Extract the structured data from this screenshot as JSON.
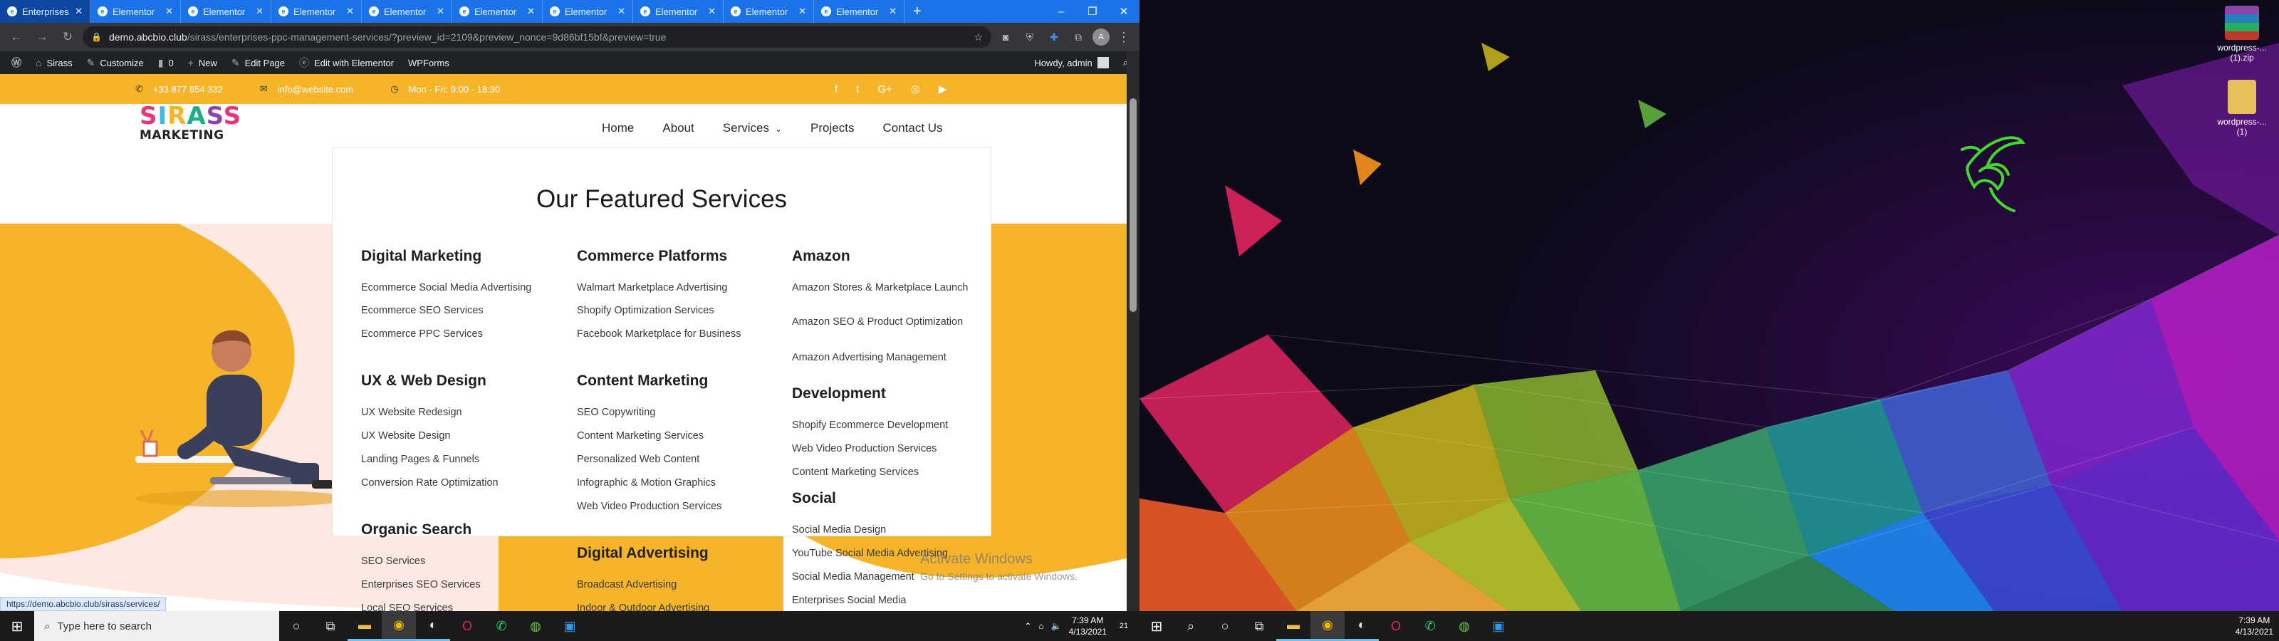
{
  "browser": {
    "tabs": [
      {
        "label": "Enterprises",
        "active": true
      },
      {
        "label": "Elementor"
      },
      {
        "label": "Elementor"
      },
      {
        "label": "Elementor"
      },
      {
        "label": "Elementor"
      },
      {
        "label": "Elementor"
      },
      {
        "label": "Elementor"
      },
      {
        "label": "Elementor"
      },
      {
        "label": "Elementor"
      },
      {
        "label": "Elementor"
      }
    ],
    "new_tab_symbol": "+",
    "window_controls": {
      "minimize": "–",
      "restore": "❐",
      "close": "✕"
    },
    "url_host": "demo.abcbio.club",
    "url_path": "/sirass/enterprises-ppc-management-services/?preview_id=2109&preview_nonce=9d86bf15bf&preview=true",
    "profile_initial": "A",
    "status_url": "https://demo.abcbio.club/sirass/services/"
  },
  "wpbar": {
    "site_name": "Sirass",
    "customize": "Customize",
    "comments_count": "0",
    "new": "New",
    "edit_page": "Edit Page",
    "edit_elementor": "Edit with Elementor",
    "wpforms": "WPForms",
    "howdy": "Howdy, admin"
  },
  "topbar": {
    "phone": "+33 877 654 332",
    "email": "info@website.com",
    "hours": "Mon - Fri: 9:00 - 18:30",
    "social": [
      "f",
      "t",
      "G+",
      "◎",
      "▶"
    ]
  },
  "logo": {
    "brand": "SIRASS",
    "sub": "MARKETING",
    "letter_colors": [
      "#e8367d",
      "#3fb7e8",
      "#f5b42a",
      "#1fae8a",
      "#8e44ad",
      "#e8367d"
    ]
  },
  "nav": {
    "items": [
      "Home",
      "About",
      "Services",
      "Projects",
      "Contact Us"
    ],
    "chevron": "⌄"
  },
  "menu": {
    "title": "Our  Featured Services",
    "columns": [
      {
        "groups": [
          {
            "title": "Digital Marketing",
            "items": [
              "Ecommerce Social Media Advertising",
              "Ecommerce SEO Services",
              "Ecommerce PPC Services"
            ]
          },
          {
            "title": "UX & Web Design",
            "items": [
              "UX Website Redesign",
              "UX Website Design",
              "Landing Pages & Funnels",
              "Conversion Rate Optimization"
            ]
          },
          {
            "title": "Organic Search",
            "items": [
              "SEO Services",
              "Enterprises SEO Services",
              "Local SEO Services"
            ]
          }
        ]
      },
      {
        "groups": [
          {
            "title": "Commerce Platforms",
            "items": [
              "Walmart Marketplace Advertising",
              "Shopify Optimization Services",
              "Facebook Marketplace for Business"
            ]
          },
          {
            "title": "Content Marketing",
            "items": [
              "SEO Copywriting",
              "Content Marketing Services",
              "Personalized Web Content",
              "Infographic & Motion Graphics",
              "Web Video Production Services"
            ]
          },
          {
            "title": "Digital Advertising",
            "items": [
              "Broadcast Advertising",
              "Indoor & Outdoor Advertising"
            ]
          }
        ]
      },
      {
        "groups": [
          {
            "title": "Amazon",
            "items": [
              "Amazon Stores & Marketplace Launch",
              "Amazon SEO & Product Optimization",
              "Amazon Advertising Management"
            ]
          },
          {
            "title": "Development",
            "items": [
              "Shopify Ecommerce Development",
              "Web Video Production Services",
              "Content Marketing Services"
            ]
          },
          {
            "title": "Social",
            "items": [
              "Social Media Design",
              "YouTube Social Media Advertising",
              "Social Media Management",
              "Enterprises Social Media"
            ]
          }
        ]
      }
    ]
  },
  "watermark": {
    "line1": "Activate Windows",
    "line2": "Go to Settings to activate Windows."
  },
  "desktop": {
    "icons": [
      {
        "label": "wordpress-...\n(1).zip",
        "color": "#c0392b"
      },
      {
        "label": "wordpress-...\n(1)",
        "color": "#e6c15a"
      }
    ],
    "logo_color": "#44d62c"
  },
  "taskbar": {
    "search_placeholder": "Type here to search",
    "time": "7:39 AM",
    "date": "4/13/2021",
    "notif_count": "21",
    "time2": "7:39 AM",
    "date2": "4/13/2021"
  },
  "colors": {
    "accent_yellow": "#f5b42a",
    "chrome_blue": "#1a73e8"
  }
}
